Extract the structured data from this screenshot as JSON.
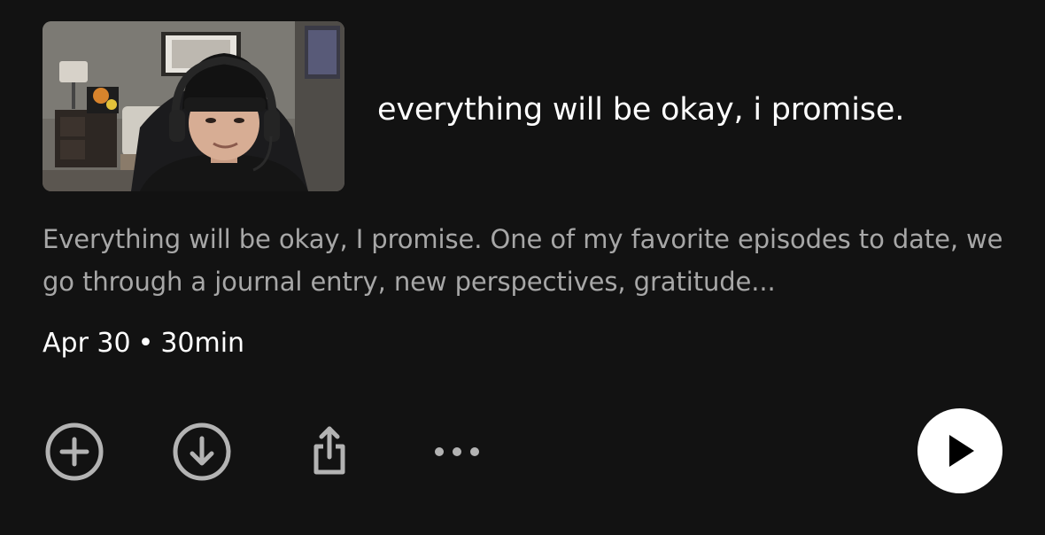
{
  "episode": {
    "title": "everything will be okay, i promise.",
    "description": "Everything will be okay, I promise. One of my favorite episodes to date, we go through a journal entry, new perspectives, gratitude...",
    "date": "Apr 30",
    "separator": "•",
    "duration": "30min",
    "thumbnail_icon": "podcast-cover-thumbnail"
  },
  "actions": {
    "add_icon": "plus-circle-icon",
    "download_icon": "download-circle-icon",
    "share_icon": "share-icon",
    "more_icon": "more-dots-icon",
    "play_icon": "play-icon"
  },
  "colors": {
    "background": "#121212",
    "title": "#ffffff",
    "description": "#a7a7a7",
    "icon": "#b3b3b3",
    "play_button": "#ffffff"
  }
}
